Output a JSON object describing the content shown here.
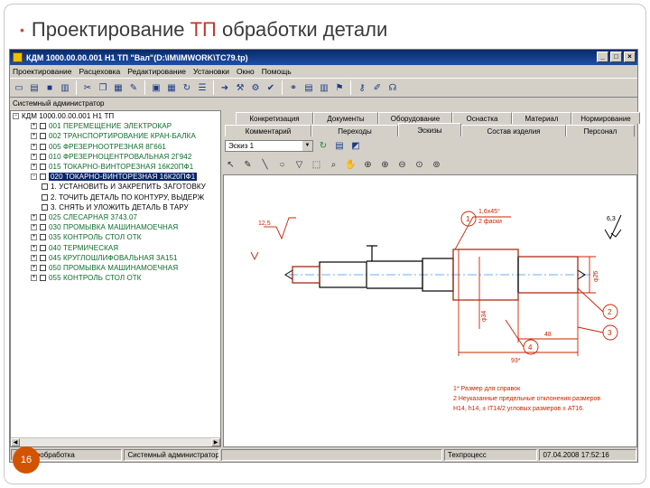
{
  "slide": {
    "bullet": "•",
    "title_start": "Проектирование ",
    "title_accent": "ТП",
    "title_end": " обработки детали",
    "page_number": "16",
    "accent_color": "#c0392b"
  },
  "window": {
    "title": "КДМ 1000.00.00.001 Н1 ТП \"Вал\"(D:\\IM\\IMWORK\\TC79.tp)",
    "min_label": "_",
    "max_label": "□",
    "close_label": "×"
  },
  "menu": {
    "items": [
      "Проектирование",
      "Расцеховка",
      "Редактирование",
      "Установки",
      "Окно",
      "Помощь"
    ]
  },
  "toolbar_icons": [
    "new-file-icon",
    "open-folder-icon",
    "save-icon",
    "print-icon",
    "cut-icon",
    "copy-icon",
    "paste-icon",
    "edit-icon",
    "calendar-icon",
    "grid-icon",
    "refresh-icon",
    "arrow-icon",
    "tools-icon",
    "settings-icon",
    "help-icon"
  ],
  "user_label": "Системный администратор",
  "tree": {
    "root": "КДМ 1000.00.00.001 Н1 ТП",
    "items": [
      {
        "text": "001  ПЕРЕМЕЩЕНИЕ  ЭЛЕКТРОКАР",
        "kind": "op"
      },
      {
        "text": "002  ТРАНСПОРТИРОВАНИЕ  КРАН-БАЛКА",
        "kind": "op"
      },
      {
        "text": "005  ФРЕЗЕРНООТРЕЗНАЯ  8Г661",
        "kind": "op"
      },
      {
        "text": "010  ФРЕЗЕРНОЦЕНТРОВАЛЬНАЯ  2Г942",
        "kind": "op"
      },
      {
        "text": "015  ТОКАРНО-ВИНТОРЕЗНАЯ  16К20ПФ1",
        "kind": "op"
      },
      {
        "text": "020  ТОКАРНО-ВИНТОРЕЗНАЯ  16К20ПФ1",
        "kind": "selected"
      },
      {
        "text": "1. УСТАНОВИТЬ И ЗАКРЕПИТЬ ЗАГОТОВКУ",
        "kind": "child"
      },
      {
        "text": "2. ТОЧИТЬ ДЕТАЛЬ ПО КОНТУРУ, ВЫДЕРЖ",
        "kind": "child"
      },
      {
        "text": "3. СНЯТЬ И УЛОЖИТЬ ДЕТАЛЬ В ТАРУ",
        "kind": "child"
      },
      {
        "text": "025  СЛЕСАРНАЯ  3743.07",
        "kind": "op"
      },
      {
        "text": "030  ПРОМЫВКА  МАШИНАМОЕЧНАЯ",
        "kind": "op"
      },
      {
        "text": "035  КОНТРОЛЬ  СТОЛ ОТК",
        "kind": "op"
      },
      {
        "text": "040  ТЕРМИЧЕСКАЯ",
        "kind": "op"
      },
      {
        "text": "045  КРУГЛОШЛИФОВАЛЬНАЯ  3А151",
        "kind": "op"
      },
      {
        "text": "050  ПРОМЫВКА  МАШИНАМОЕЧНАЯ",
        "kind": "op"
      },
      {
        "text": "055  КОНТРОЛЬ  СТОЛ ОТК",
        "kind": "op"
      }
    ]
  },
  "tabs_top": [
    "Конкретизация",
    "Документы",
    "Оборудование",
    "Оснастка",
    "Материал",
    "Нормирование"
  ],
  "tabs_bottom": [
    "Комментарий",
    "Переходы",
    "Эскизы",
    "Состав изделия",
    "Персонал"
  ],
  "active_tab": "Эскизы",
  "sketch_combo": "Эскиз 1",
  "drawing": {
    "roughness_top": "6,3",
    "roughness_left": "12,5",
    "callout_1": "1",
    "callout_2": "2",
    "callout_3": "3",
    "callout_4": "4",
    "chamfer": "1,6х45°",
    "chamfer_2": "2 фаски",
    "dia_right": "φ26",
    "dia_mid": "φ34",
    "len_48": "48",
    "len_93": "93*",
    "note_1": "1* Размер для справок",
    "note_2": "2 Неуказанные предельные отклонения размеров",
    "note_3": "Н14, h14, ± IT14/2 угловых размеров ± AT16.",
    "line_color": "#cc2200",
    "part_color": "#000000",
    "axis_color": "#3399ff"
  },
  "status": [
    "Механообработка",
    "Системный администратор",
    "",
    "Техпроцесс",
    "07.04.2008  17:52:16"
  ]
}
